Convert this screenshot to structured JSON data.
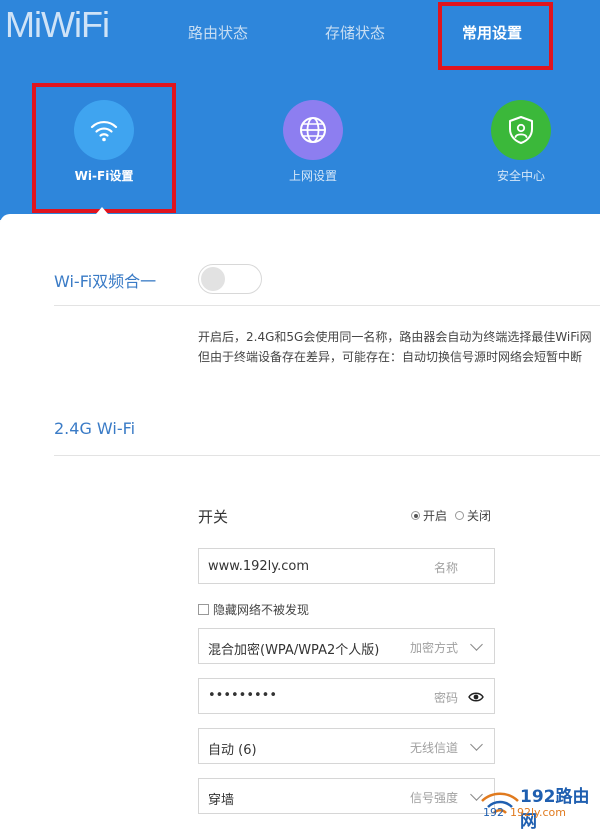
{
  "header": {
    "logo": "MiWiFi",
    "nav": [
      "路由状态",
      "存储状态",
      "常用设置"
    ],
    "active_nav": "常用设置",
    "bg_color": "#2e86db"
  },
  "tiles": [
    {
      "label": "Wi-Fi设置",
      "icon": "wifi-icon",
      "color": "#3fa4f0"
    },
    {
      "label": "上网设置",
      "icon": "globe-icon",
      "color": "#8d7ef0"
    },
    {
      "label": "安全中心",
      "icon": "shield-icon",
      "color": "#3bb83a"
    }
  ],
  "dual_band": {
    "title": "Wi-Fi双频合一",
    "toggle_on": false,
    "desc_line1": "开启后，2.4G和5G会使用同一名称，路由器会自动为终端选择最佳WiFi网",
    "desc_line2": "但由于终端设备存在差异，可能存在：自动切换信号源时网络会短暂中断"
  },
  "wifi24": {
    "title": "2.4G Wi-Fi",
    "switch_label": "开关",
    "radio_on": "开启",
    "radio_off": "关闭",
    "ssid_value": "www.192ly.com",
    "ssid_hint": "名称",
    "hide_label": "隐藏网络不被发现",
    "encryption_value": "混合加密(WPA/WPA2个人版)",
    "encryption_hint": "加密方式",
    "password_value": "•••••••••",
    "password_hint": "密码",
    "channel_value": "自动 (6)",
    "channel_hint": "无线信道",
    "strength_value": "穿墙",
    "strength_hint": "信号强度"
  },
  "watermark": {
    "text": "192路由网",
    "url": "192ly.com",
    "prefix": "192"
  }
}
